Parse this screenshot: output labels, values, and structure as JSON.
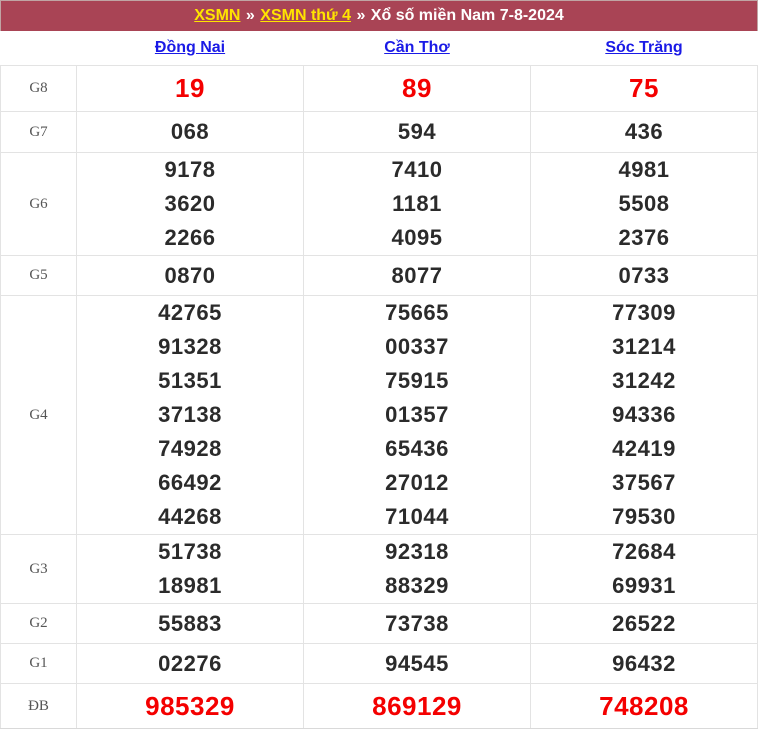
{
  "header": {
    "link1": "XSMN",
    "sep1": "»",
    "link2": "XSMN thứ 4",
    "sep2": "»",
    "title": "Xổ số miền Nam 7-8-2024",
    "bar_color": "#a94455",
    "link_color": "#ffe400"
  },
  "table": {
    "corner_label": "",
    "provinces": [
      "Đồng Nai",
      "Cần Thơ",
      "Sóc Trăng"
    ],
    "province_link_color": "#1a1ae6",
    "highlight_color": "#f40000",
    "rows": [
      {
        "label": "G8",
        "highlight": true,
        "values": [
          [
            "19"
          ],
          [
            "89"
          ],
          [
            "75"
          ]
        ]
      },
      {
        "label": "G7",
        "highlight": false,
        "values": [
          [
            "068"
          ],
          [
            "594"
          ],
          [
            "436"
          ]
        ]
      },
      {
        "label": "G6",
        "highlight": false,
        "values": [
          [
            "9178",
            "3620",
            "2266"
          ],
          [
            "7410",
            "1181",
            "4095"
          ],
          [
            "4981",
            "5508",
            "2376"
          ]
        ]
      },
      {
        "label": "G5",
        "highlight": false,
        "values": [
          [
            "0870"
          ],
          [
            "8077"
          ],
          [
            "0733"
          ]
        ]
      },
      {
        "label": "G4",
        "highlight": false,
        "values": [
          [
            "42765",
            "91328",
            "51351",
            "37138",
            "74928",
            "66492",
            "44268"
          ],
          [
            "75665",
            "00337",
            "75915",
            "01357",
            "65436",
            "27012",
            "71044"
          ],
          [
            "77309",
            "31214",
            "31242",
            "94336",
            "42419",
            "37567",
            "79530"
          ]
        ]
      },
      {
        "label": "G3",
        "highlight": false,
        "values": [
          [
            "51738",
            "18981"
          ],
          [
            "92318",
            "88329"
          ],
          [
            "72684",
            "69931"
          ]
        ]
      },
      {
        "label": "G2",
        "highlight": false,
        "values": [
          [
            "55883"
          ],
          [
            "73738"
          ],
          [
            "26522"
          ]
        ]
      },
      {
        "label": "G1",
        "highlight": false,
        "values": [
          [
            "02276"
          ],
          [
            "94545"
          ],
          [
            "96432"
          ]
        ]
      },
      {
        "label": "ĐB",
        "highlight": true,
        "values": [
          [
            "985329"
          ],
          [
            "869129"
          ],
          [
            "748208"
          ]
        ]
      }
    ]
  }
}
